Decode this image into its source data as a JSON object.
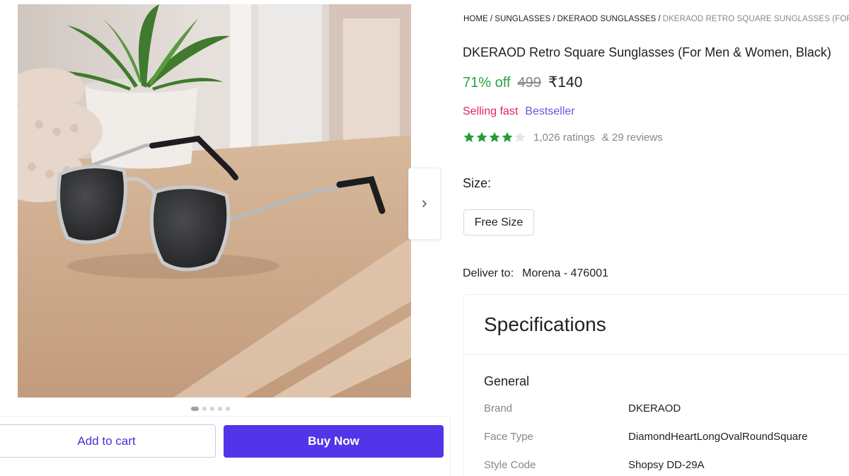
{
  "breadcrumb": {
    "items": [
      "HOME",
      "SUNGLASSES",
      "DKERAOD SUNGLASSES",
      "DKERAOD RETRO SQUARE SUNGLASSES (FOR MEN & WOMEN, BLACK)"
    ],
    "separator": "/"
  },
  "product": {
    "title": "DKERAOD Retro Square Sunglasses (For Men & Women, Black)",
    "discount": "71% off",
    "mrp": "499",
    "price": "₹140",
    "tag_selling": "Selling fast",
    "tag_best": "Bestseller",
    "rating_value": 4,
    "rating_max": 5,
    "ratings_count": "1,026 ratings",
    "reviews_count": "& 29 reviews"
  },
  "size": {
    "label": "Size:",
    "option": "Free Size"
  },
  "delivery": {
    "label": "Deliver to:",
    "location": "Morena - 476001"
  },
  "specifications": {
    "title": "Specifications",
    "section": "General",
    "rows": [
      {
        "key": "Brand",
        "value": "DKERAOD"
      },
      {
        "key": "Face Type",
        "value": "DiamondHeartLongOvalRoundSquare"
      },
      {
        "key": "Style Code",
        "value": "Shopsy DD-29A"
      }
    ]
  },
  "gallery": {
    "image_count": 5,
    "active_index": 0
  },
  "actions": {
    "add_to_cart": "Add to cart",
    "buy_now": "Buy Now"
  },
  "colors": {
    "discount": "#26a541",
    "selling": "#e0245e",
    "bestseller": "#6e54e0",
    "primary": "#5235e8",
    "star": "#1f9e3a"
  },
  "icons": {
    "next": "chevron-right-icon",
    "star": "star-icon"
  }
}
